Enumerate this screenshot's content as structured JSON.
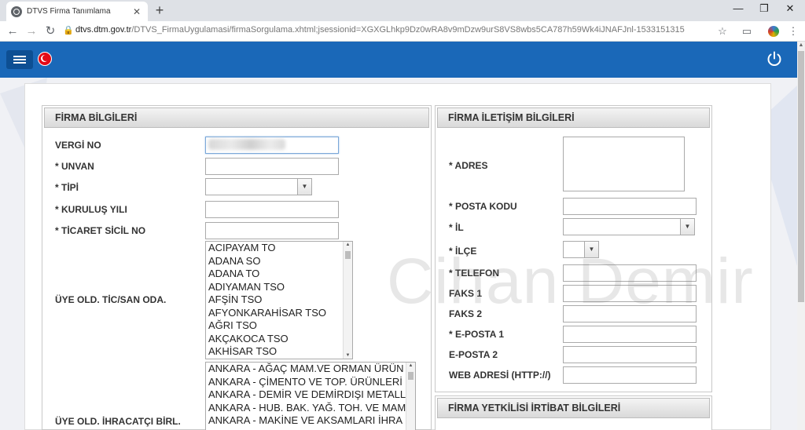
{
  "browser": {
    "tab_title": "DTVS Firma Tanımlama",
    "tab_close": "✕",
    "new_tab": "+",
    "window_controls": [
      "—",
      "❐",
      "✕"
    ],
    "url_host": "dtvs.dtm.gov.tr",
    "url_path": "/DTVS_FirmaUygulamasi/firmaSorgulama.xhtml;jsessionid=XGXGLhkp9Dz0wRA8v9mDzw9urS8VS8wbs5CA787h59Wk4iJNAFJnl-1533151315"
  },
  "colors": {
    "header": "#1a68b8",
    "header_dark": "#0d4f93"
  },
  "watermark": "Cihan Demir",
  "firma_bilgileri": {
    "title": "FİRMA BİLGİLERİ",
    "vergi_no": "VERGİ NO",
    "unvan": "* UNVAN",
    "tipi": "* TİPİ",
    "kurulus_yili": "* KURULUŞ YILI",
    "ticaret_sicil_no": "* TİCARET SİCİL NO",
    "uye_tic_san_oda": "ÜYE OLD. TİC/SAN ODA.",
    "uye_ihracatci_birl": "ÜYE OLD. İHRACATÇI BİRL.",
    "oda_options": [
      "ACIPAYAM TO",
      "ADANA SO",
      "ADANA TO",
      "ADIYAMAN TSO",
      "AFŞİN TSO",
      "AFYONKARAHİSAR TSO",
      "AĞRI TSO",
      "AKÇAKOCA TSO",
      "AKHİSAR TSO"
    ],
    "birlik_options": [
      "ANKARA - AĞAÇ MAM.VE ORMAN ÜRÜN",
      "ANKARA - ÇİMENTO VE TOP. ÜRÜNLERİ",
      "ANKARA - DEMİR VE DEMİRDIŞI METALL",
      "ANKARA - HUB. BAK. YAĞ. TOH. VE MAM",
      "ANKARA - MAKİNE VE AKSAMLARI İHRA"
    ]
  },
  "firma_iletisim": {
    "title": "FİRMA İLETİŞİM BİLGİLERİ",
    "adres": "* ADRES",
    "posta_kodu": "* POSTA KODU",
    "il": "* İL",
    "ilce": "* İLÇE",
    "telefon": "* TELEFON",
    "faks1": "FAKS 1",
    "faks2": "FAKS 2",
    "eposta1": "* E-POSTA 1",
    "eposta2": "E-POSTA 2",
    "web": "WEB ADRESİ (HTTP://)"
  },
  "firma_yetkilisi": {
    "title": "FİRMA YETKİLİSİ İRTİBAT BİLGİLERİ"
  }
}
